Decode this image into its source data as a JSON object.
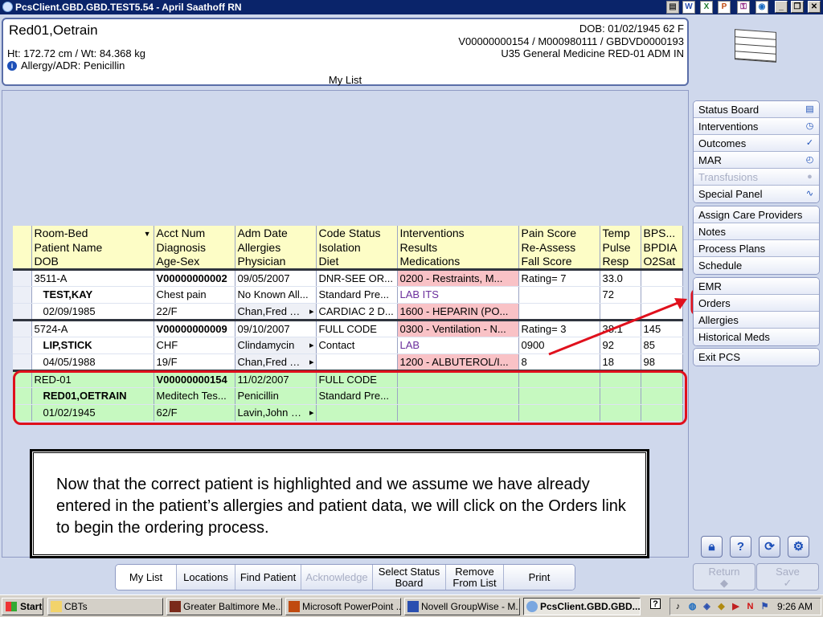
{
  "window": {
    "title": "PcsClient.GBD.GBD.TEST5.54 - April Saathoff RN"
  },
  "patient_header": {
    "name": "Red01,Oetrain",
    "height_weight": "Ht: 172.72 cm / Wt: 84.368 kg",
    "allergy": "Allergy/ADR: Penicillin",
    "dob_age_sex": "DOB: 01/02/1945 62 F",
    "account_line": "V00000000154 / M000980111 / GBDVD0000193",
    "location_line": "U35 General Medicine  RED-01  ADM IN",
    "view_title": "My List"
  },
  "table": {
    "headers": [
      [
        "Room-Bed",
        "Acct Num",
        "Adm Date",
        "Code Status",
        "Interventions",
        "Pain Score",
        "Temp",
        "BPS..."
      ],
      [
        "Patient Name",
        "Diagnosis",
        "Allergies",
        "Isolation",
        "Results",
        "Re-Assess",
        "Pulse",
        "BPDIA"
      ],
      [
        "DOB",
        "Age-Sex",
        "Physician",
        "Diet",
        "Medications",
        "Fall Score",
        "Resp",
        "O2Sat"
      ]
    ],
    "patients": [
      {
        "rows": [
          [
            "3511-A",
            "V00000000002",
            "09/05/2007",
            "DNR-SEE OR...",
            "0200 - Restraints, M...",
            "Rating= 7",
            "33.0",
            ""
          ],
          [
            "TEST,KAY",
            "Chest pain",
            "No Known All...",
            "Standard Pre...",
            "LAB ITS",
            "",
            "72",
            ""
          ],
          [
            "02/09/1985",
            "22/F",
            "Chan,Fred T ...",
            "CARDIAC 2 D...",
            "1600 - HEPARIN (PO...",
            "",
            "",
            ""
          ]
        ]
      },
      {
        "rows": [
          [
            "5724-A",
            "V00000000009",
            "09/10/2007",
            "FULL CODE",
            "0300 - Ventilation - N...",
            "Rating= 3",
            "38.1",
            "145"
          ],
          [
            "LIP,STICK",
            "CHF",
            "Clindamycin",
            "Contact",
            "LAB",
            "0900",
            "92",
            "85"
          ],
          [
            "04/05/1988",
            "19/F",
            "Chan,Fred T ...",
            "",
            "1200 - ALBUTEROL/I...",
            "8",
            "18",
            "98"
          ]
        ]
      },
      {
        "rows": [
          [
            "RED-01",
            "V00000000154",
            "11/02/2007",
            "FULL CODE",
            "",
            "",
            "",
            ""
          ],
          [
            "RED01,OETRAIN",
            "Meditech Tes...",
            "Penicillin",
            "Standard Pre...",
            "",
            "",
            "",
            ""
          ],
          [
            "01/02/1945",
            "62/F",
            "Lavin,John G ...",
            "",
            "",
            "",
            "",
            ""
          ]
        ]
      }
    ]
  },
  "instruction_text": "Now that the correct patient is highlighted and we assume we have already entered in the patient’s allergies and patient data, we will click on the Orders link to begin the ordering process.",
  "sidebar": {
    "group1": [
      {
        "label": "Status Board",
        "icon": "book-icon"
      },
      {
        "label": "Interventions",
        "icon": "clock-icon"
      },
      {
        "label": "Outcomes",
        "icon": "check-icon"
      },
      {
        "label": "MAR",
        "icon": "timer-icon"
      },
      {
        "label": "Transfusions",
        "icon": "drop-icon",
        "disabled": true
      },
      {
        "label": "Special Panel",
        "icon": "pulse-icon"
      }
    ],
    "group2": [
      {
        "label": "Assign Care Providers"
      },
      {
        "label": "Notes"
      },
      {
        "label": "Process Plans"
      },
      {
        "label": "Schedule"
      }
    ],
    "group3": [
      {
        "label": "EMR"
      },
      {
        "label": "Orders"
      },
      {
        "label": "Allergies"
      },
      {
        "label": "Historical Meds"
      }
    ],
    "group4": [
      {
        "label": "Exit PCS"
      }
    ],
    "return_label": "Return",
    "save_label": "Save"
  },
  "bottom_toolbar": [
    {
      "label": "My List",
      "active": true
    },
    {
      "label": "Locations"
    },
    {
      "label": "Find Patient"
    },
    {
      "label": "Acknowledge",
      "disabled": true
    },
    {
      "label": "Select Status Board"
    },
    {
      "label": "Remove From List"
    },
    {
      "label": "Print"
    }
  ],
  "taskbar": {
    "start_label": "Start",
    "tasks": [
      "CBTs",
      "Greater Baltimore Me...",
      "Microsoft PowerPoint ...",
      "Novell GroupWise - M...",
      "PcsClient.GBD.GBD...."
    ],
    "clock": "9:26 AM"
  },
  "colors": {
    "title_bar": "#0a246a",
    "header_row": "#fdfdc6",
    "selected_row": "#c6f9c0",
    "intervention_due": "#f9c2c6",
    "annotation": "#e0101c"
  }
}
